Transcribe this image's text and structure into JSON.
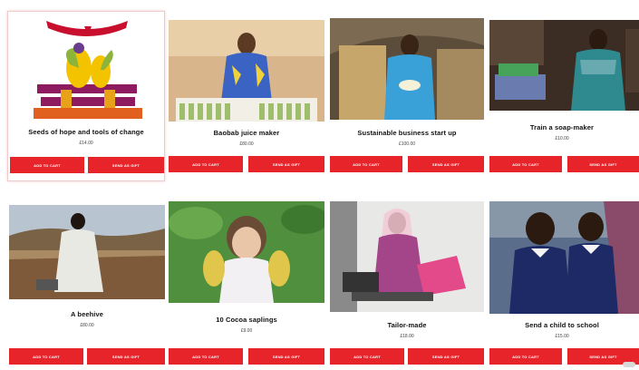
{
  "products": [
    {
      "title": "Seeds of hope and tools of change",
      "price": "£14.00",
      "add_label": "ADD TO CART",
      "gift_label": "SEND AS GIFT",
      "icon": "seeds-illustration"
    },
    {
      "title": "Baobab juice maker",
      "price": "£80.00",
      "add_label": "ADD TO CART",
      "gift_label": "SEND AS GIFT",
      "icon": "juice-maker-photo"
    },
    {
      "title": "Sustainable business start up",
      "price": "£100.00",
      "add_label": "ADD TO CART",
      "gift_label": "SEND AS GIFT",
      "icon": "business-photo"
    },
    {
      "title": "Train a soap-maker",
      "price": "£10.00",
      "add_label": "ADD TO CART",
      "gift_label": "SEND AS GIFT",
      "icon": "soap-maker-photo"
    },
    {
      "title": "A beehive",
      "price": "£80.00",
      "add_label": "ADD TO CART",
      "gift_label": "SEND AS GIFT",
      "icon": "beehive-photo"
    },
    {
      "title": "10 Cocoa saplings",
      "price": "£9.00",
      "add_label": "ADD TO CART",
      "gift_label": "SEND AS GIFT",
      "icon": "cocoa-photo"
    },
    {
      "title": "Tailor-made",
      "price": "£18.00",
      "add_label": "ADD TO CART",
      "gift_label": "SEND AS GIFT",
      "icon": "tailor-photo"
    },
    {
      "title": "Send a child to school",
      "price": "£15.00",
      "add_label": "ADD TO CART",
      "gift_label": "SEND AS GIFT",
      "icon": "school-photo"
    }
  ],
  "colors": {
    "button": "#e8242b",
    "background": "#ffffff"
  }
}
